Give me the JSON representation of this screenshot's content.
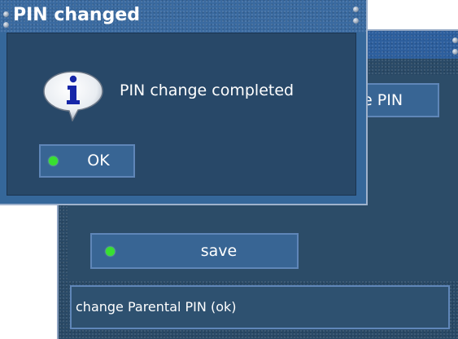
{
  "back_window": {
    "partial_button_label": "ge PIN",
    "save_button_label": "save",
    "status_text": "change Parental PIN (ok)"
  },
  "dialog": {
    "title": "PIN changed",
    "icon": "info-icon",
    "message": "PIN change completed",
    "ok_button_label": "OK"
  },
  "colors": {
    "window_blue": "#2f5679",
    "title_blue": "#3a6aa0",
    "button_blue": "#386594",
    "button_border": "#5f86b8",
    "indicator_green": "#38e030",
    "text": "#ffffff"
  }
}
